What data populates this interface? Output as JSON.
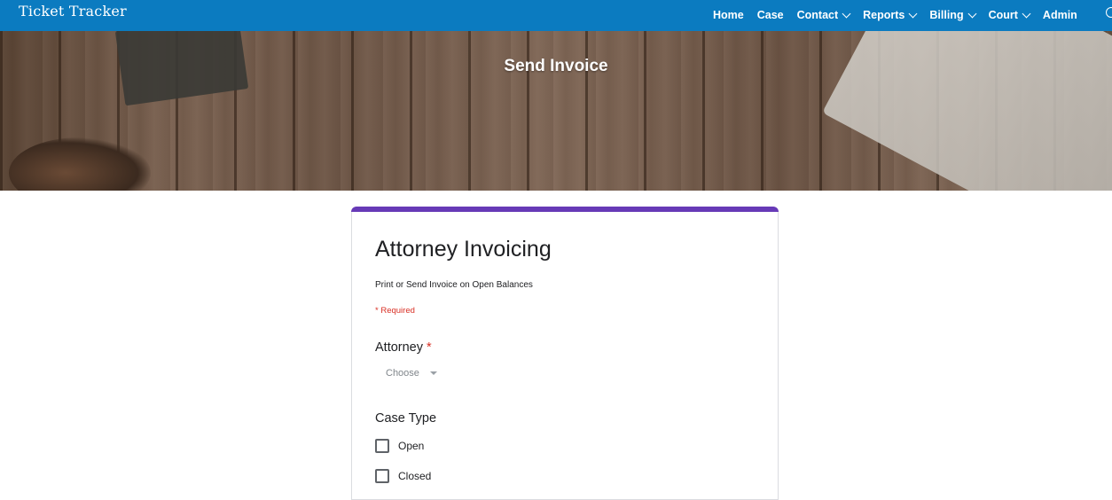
{
  "app": {
    "brand": "Ticket Tracker"
  },
  "nav": {
    "items": [
      {
        "label": "Home",
        "dropdown": false
      },
      {
        "label": "Case",
        "dropdown": false
      },
      {
        "label": "Contact",
        "dropdown": true
      },
      {
        "label": "Reports",
        "dropdown": true
      },
      {
        "label": "Billing",
        "dropdown": true
      },
      {
        "label": "Court",
        "dropdown": true
      },
      {
        "label": "Admin",
        "dropdown": false
      }
    ],
    "search_icon": "search-icon"
  },
  "hero": {
    "title": "Send Invoice"
  },
  "form": {
    "title": "Attorney Invoicing",
    "description": "Print or Send Invoice on Open Balances",
    "required_note": "* Required",
    "accent_color": "#673ab7",
    "questions": {
      "attorney": {
        "label": "Attorney",
        "required_mark": "*",
        "placeholder": "Choose"
      },
      "case_type": {
        "label": "Case Type",
        "options": [
          "Open",
          "Closed"
        ]
      }
    }
  },
  "colors": {
    "navbar": "#0b7bc0",
    "required": "#d93025"
  }
}
